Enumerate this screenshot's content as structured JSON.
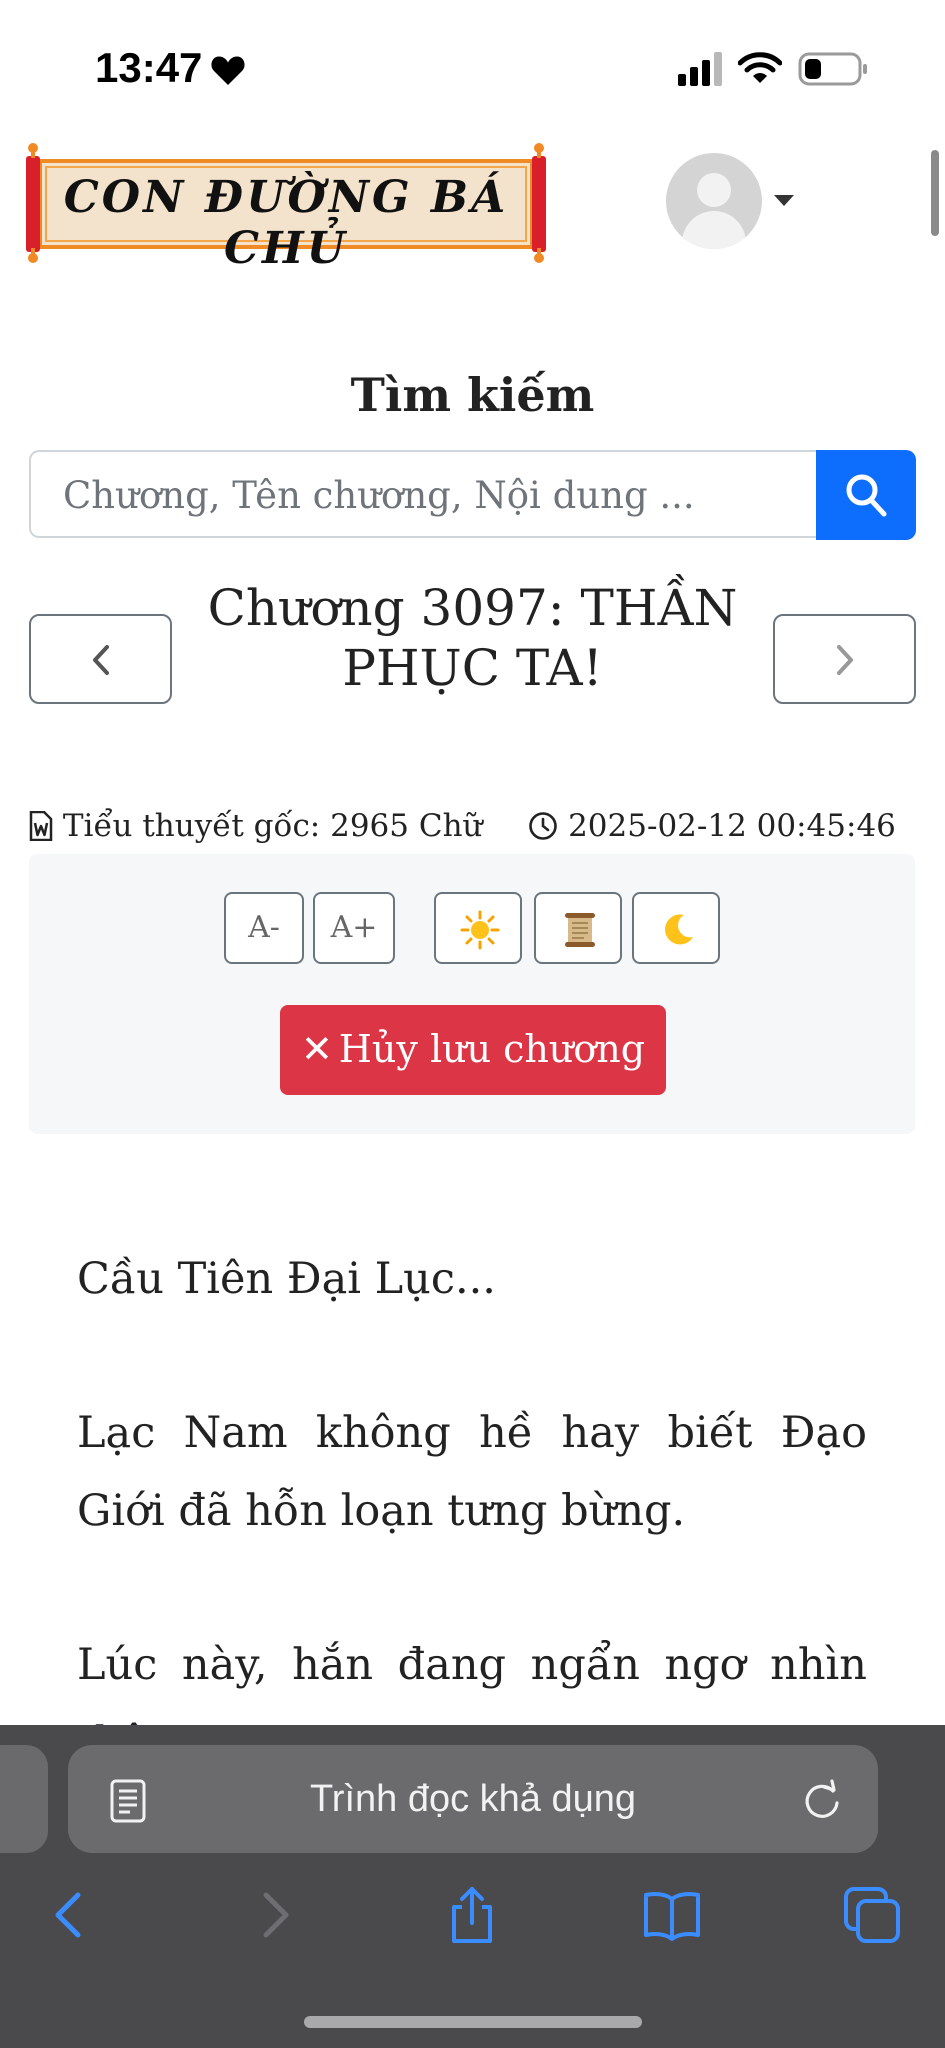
{
  "status_bar": {
    "time": "13:47"
  },
  "header": {
    "logo_text": "CON ĐƯỜNG BÁ CHỦ"
  },
  "search": {
    "title": "Tìm kiếm",
    "placeholder": "Chương, Tên chương, Nội dung ..."
  },
  "chapter": {
    "title_line1": "Chương 3097: THẦN",
    "title_line2": "PHỤC TA!",
    "word_count": "Tiểu thuyết gốc: 2965 Chữ",
    "timestamp": "2025-02-12 00:45:46"
  },
  "reader_tools": {
    "font_smaller": "A-",
    "font_larger": "A+",
    "unsave_label": "Hủy lưu chương",
    "unsave_icon": "✕",
    "themes": [
      "sun-icon",
      "scroll-icon",
      "moon-icon"
    ]
  },
  "content": {
    "paragraphs": [
      "Cầu Tiên Đại Lục...",
      "Lạc Nam không hề hay biết Đạo Giới đã hỗn loạn tưng bừng.",
      "Lúc này, hắn đang ngẩn ngơ nhìn thân"
    ]
  },
  "browser": {
    "address_text": "Trình đọc khả dụng",
    "icons": [
      "reader-icon",
      "reload-icon",
      "back-icon",
      "forward-icon",
      "share-icon",
      "bookmarks-icon",
      "tabs-icon"
    ]
  },
  "colors": {
    "accent_blue": "#0d6efd",
    "danger_red": "#dc3545",
    "scroll_red": "#d9202a",
    "ios_blue": "#3a8cff"
  }
}
